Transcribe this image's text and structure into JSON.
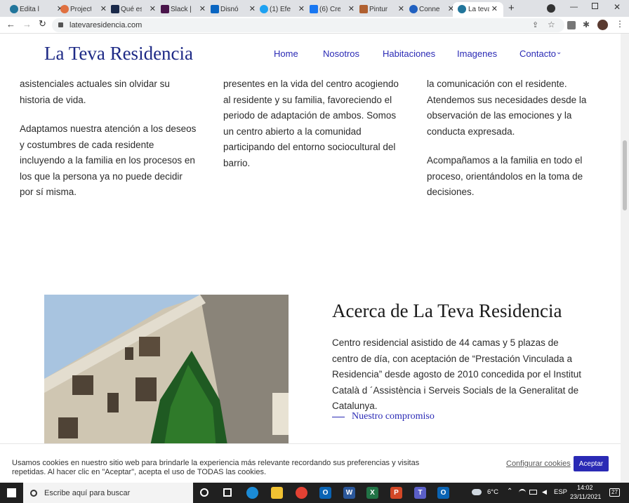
{
  "browser": {
    "tabs": [
      {
        "title": "Edita l",
        "color": "#21759b"
      },
      {
        "title": "Project",
        "color": "#e07040"
      },
      {
        "title": "Qué es",
        "color": "#1a2a4a"
      },
      {
        "title": "Slack |",
        "color": "#4a154b"
      },
      {
        "title": "Disnó",
        "color": "#0a66c2"
      },
      {
        "title": "(1) Efe",
        "color": "#1da1f2"
      },
      {
        "title": "(6) Cre",
        "color": "#1877f2"
      },
      {
        "title": "Pintur",
        "color": "#b06030"
      },
      {
        "title": "Conne",
        "color": "#2060c0"
      },
      {
        "title": "La teva",
        "color": "#21759b"
      }
    ],
    "url": "latevaresidencia.com"
  },
  "header": {
    "logo": "La Teva Residencia",
    "nav": [
      "Home",
      "Nosotros",
      "Habitaciones",
      "Imagenes",
      "Contacto"
    ]
  },
  "columns": {
    "col1": {
      "p1": "asistenciales actuales sin olvidar su historia de vida.",
      "p2": "Adaptamos nuestra atención a los deseos y costumbres de cada residente incluyendo a la familia en los procesos en los que la persona ya no puede decidir por sí misma."
    },
    "col2": {
      "p1": "presentes en la vida del centro acogiendo al residente y su familia, favoreciendo el periodo de adaptación de ambos. Somos un centro abierto a la comunidad participando del entorno sociocultural del barrio."
    },
    "col3": {
      "p1": "la comunicación con el residente. Atendemos sus necesidades desde la observación de las emociones y la conducta expresada.",
      "p2": "Acompañamos a la familia en todo el proceso, orientándolos en la toma de decisiones."
    }
  },
  "about": {
    "title": "Acerca de La Teva Residencia",
    "body": "Centro residencial asistido de 44 camas y 5 plazas de centro de día, con aceptación de “Prestación Vinculada a Residencia” desde agosto de 2010 concedida por el Institut Català d ´Assistència i Serveis Socials de la Generalitat de Catalunya.",
    "link": "Nuestro compromiso"
  },
  "cookie": {
    "text": "Usamos cookies en nuestro sitio web para brindarle la experiencia más relevante recordando sus preferencias y visitas repetidas. Al hacer clic en \"Aceptar\", acepta el uso de TODAS las cookies.",
    "configure": "Configurar cookies",
    "accept": "Aceptar"
  },
  "taskbar": {
    "search_placeholder": "Escribe aquí para buscar",
    "temp": "6°C",
    "lang": "ESP",
    "time": "14:02",
    "date": "23/11/2021",
    "notif": "27"
  }
}
